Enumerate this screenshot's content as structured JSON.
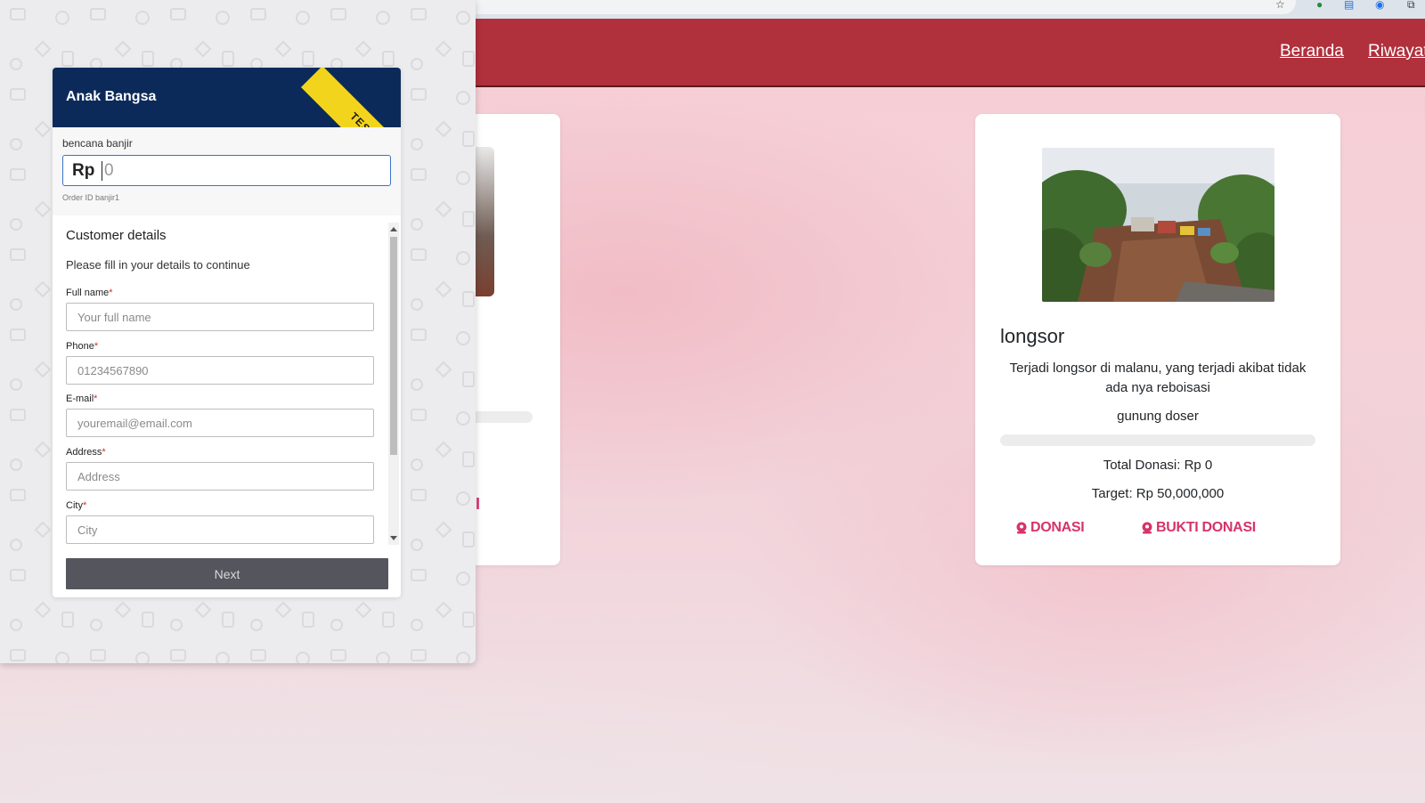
{
  "nav": {
    "links": [
      "Beranda",
      "Riwayat"
    ]
  },
  "campaign": {
    "title": "longsor",
    "description": "Terjadi longsor di malanu, yang terjadi akibat tidak ada nya reboisasi",
    "location": "gunung doser",
    "progress_fraction": 0,
    "total": "Total Donasi: Rp 0",
    "target": "Target: Rp 50,000,000",
    "donate_label": "DONASI",
    "proof_label": "BUKTI DONASI"
  },
  "left_card": {
    "link_fragment": "I"
  },
  "payment": {
    "merchant": "Anak Bangsa",
    "ribbon": "TEST",
    "item_name": "bencana banjir",
    "currency": "Rp",
    "amount": "0",
    "order_id": "Order ID banjir1",
    "section_title": "Customer details",
    "section_subtitle": "Please fill in your details to continue",
    "fields": [
      {
        "label": "Full name",
        "required": "*",
        "placeholder": "Your full name"
      },
      {
        "label": "Phone",
        "required": "*",
        "placeholder": "01234567890"
      },
      {
        "label": "E-mail",
        "required": "*",
        "placeholder": "youremail@email.com"
      },
      {
        "label": "Address",
        "required": "*",
        "placeholder": "Address"
      },
      {
        "label": "City",
        "required": "*",
        "placeholder": "City"
      }
    ],
    "next_label": "Next"
  },
  "colors": {
    "header": "#b0303c",
    "accent": "#d6336c",
    "pay_header": "#0b2a5a",
    "ribbon": "#f2d41c",
    "next_button": "#55565d"
  },
  "icons": [
    "star-icon",
    "extension-icon",
    "doc-icon",
    "profile-icon",
    "map-pin-icon"
  ]
}
